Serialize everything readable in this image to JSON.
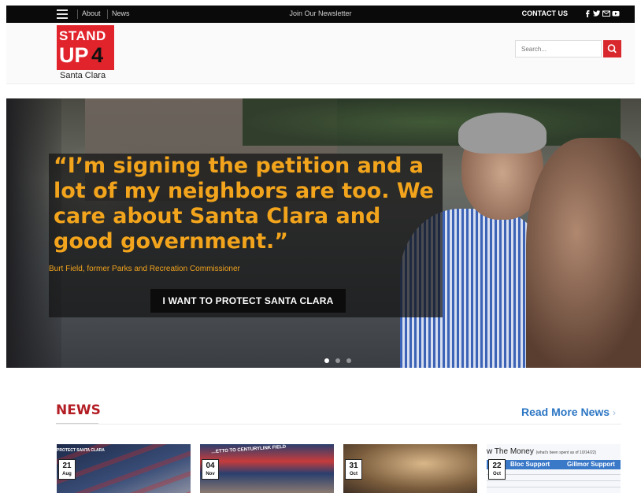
{
  "topbar": {
    "about": "About",
    "news": "News",
    "newsletter": "Join Our Newsletter",
    "contact": "CONTACT US",
    "social_icons": [
      "facebook-icon",
      "twitter-icon",
      "email-icon",
      "youtube-icon"
    ]
  },
  "logo": {
    "stand": "STAND",
    "up": "UP",
    "four": "4",
    "city": "Santa Clara"
  },
  "search": {
    "placeholder": "Search..."
  },
  "hero": {
    "quote": "“I’m signing the petition and a lot of my neighbors are too. We care about Santa Clara and good government.”",
    "attribution": "Burt Field, former Parks and Recreation Commissioner",
    "cta": "I WANT TO PROTECT SANTA CLARA",
    "slides": 3,
    "active_slide": 1
  },
  "news": {
    "title": "NEWS",
    "read_more": "Read More News",
    "cards": [
      {
        "day": "21",
        "month": "Aug",
        "overlay": "PROTECT SANTA CLARA"
      },
      {
        "day": "04",
        "month": "Nov",
        "overlay": "…ETTO TO CENTURYLINK FIELD"
      },
      {
        "day": "31",
        "month": "Oct"
      },
      {
        "day": "22",
        "month": "Oct",
        "headline": "w The Money",
        "note": "(what's been spent as of 10/14/22)",
        "col1": "Bloc Support",
        "col2": "Gillmor Support"
      }
    ]
  },
  "colors": {
    "brand_red": "#e1232b",
    "news_red": "#b31d24",
    "quote_orange": "#f2a41c",
    "link_blue": "#2c76c4"
  }
}
